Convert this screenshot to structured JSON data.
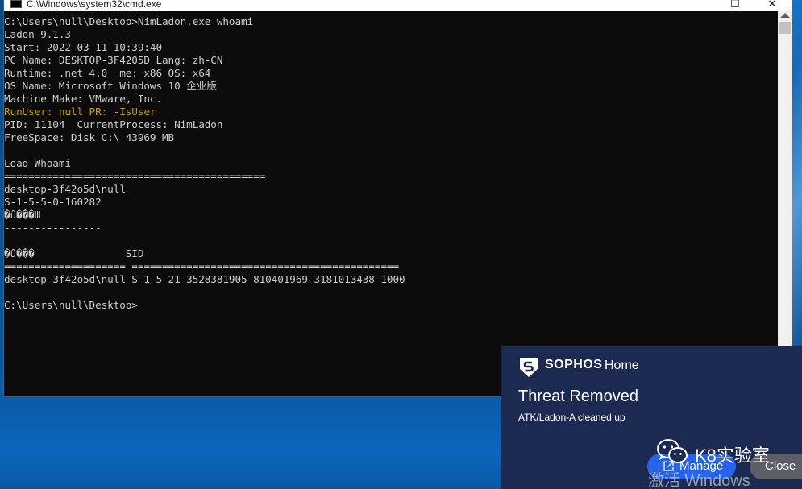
{
  "window": {
    "title": "C:\\Windows\\system32\\cmd.exe",
    "maximize_glyph": "☐",
    "close_glyph": "✕"
  },
  "console": {
    "lines": [
      {
        "text": "C:\\Users\\null\\Desktop>NimLadon.exe whoami",
        "color": "default"
      },
      {
        "text": "Ladon 9.1.3",
        "color": "default"
      },
      {
        "text": "Start: 2022-03-11 10:39:40",
        "color": "default"
      },
      {
        "text": "PC Name: DESKTOP-3F4205D Lang: zh-CN",
        "color": "default"
      },
      {
        "text": "Runtime: .net 4.0  me: x86 OS: x64",
        "color": "default"
      },
      {
        "text": "OS Name: Microsoft Windows 10 企业版",
        "color": "default"
      },
      {
        "text": "Machine Make: VMware, Inc.",
        "color": "default"
      },
      {
        "text": "RunUser: null PR: -IsUser",
        "color": "yellow"
      },
      {
        "text": "PID: 11104  CurrentProcess: NimLadon",
        "color": "default"
      },
      {
        "text": "FreeSpace: Disk C:\\ 43969 MB",
        "color": "default"
      },
      {
        "text": "",
        "color": "default"
      },
      {
        "text": "Load Whoami",
        "color": "default"
      },
      {
        "text": "===========================================",
        "color": "default"
      },
      {
        "text": "desktop-3f42o5d\\null",
        "color": "default"
      },
      {
        "text": "S-1-5-5-0-160282",
        "color": "default"
      },
      {
        "text": "�û���Ш",
        "color": "default"
      },
      {
        "text": "----------------",
        "color": "default"
      },
      {
        "text": "",
        "color": "default"
      },
      {
        "text": "�û���               SID",
        "color": "default"
      },
      {
        "text": "==================== ============================================",
        "color": "default"
      },
      {
        "text": "desktop-3f42o5d\\null S-1-5-21-3528381905-810401969-3181013438-1000",
        "color": "default"
      },
      {
        "text": "",
        "color": "default"
      },
      {
        "text": "C:\\Users\\null\\Desktop>",
        "color": "default"
      }
    ]
  },
  "toast": {
    "brand": "SOPHOS",
    "brand_sub": "Home",
    "title": "Threat Removed",
    "body": "ATK/Ladon-A cleaned up",
    "manage_label": "Manage",
    "close_label": "Close",
    "icons": {
      "brand": "sophos-shield-icon",
      "manage": "external-link-icon"
    }
  },
  "watermark": {
    "channel": "K8实验室",
    "activate": "激活 Windows",
    "icon": "wechat-icon"
  },
  "colors": {
    "console_bg": "#0c0c0c",
    "console_text": "#cccccc",
    "console_yellow": "#c19c00",
    "toast_bg": "#1c2a52",
    "manage_button": "#2563eb",
    "close_button": "#5c6066"
  }
}
